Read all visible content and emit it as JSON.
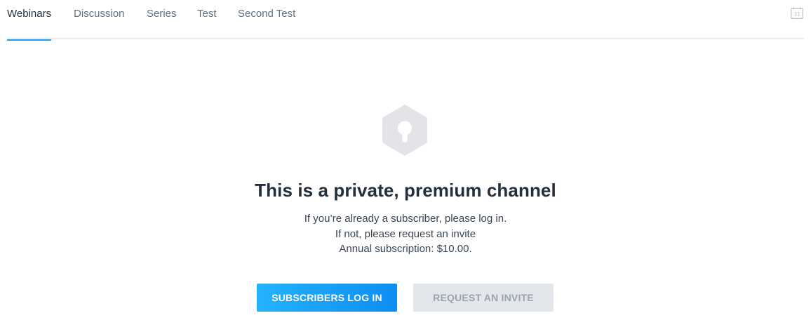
{
  "tabs": [
    {
      "label": "Webinars",
      "active": true
    },
    {
      "label": "Discussion",
      "active": false
    },
    {
      "label": "Series",
      "active": false
    },
    {
      "label": "Test",
      "active": false
    },
    {
      "label": "Second Test",
      "active": false
    }
  ],
  "calendar": {
    "icon": "calendar-icon",
    "day": "31"
  },
  "lock": {
    "icon": "keyhole-lock-icon"
  },
  "message": {
    "title": "This is a private, premium channel",
    "line1": "If you’re already a subscriber, please log in.",
    "line2": "If not, please request an invite",
    "line3": "Annual subscription: $10.00."
  },
  "buttons": {
    "login": "SUBSCRIBERS LOG IN",
    "invite": "REQUEST AN INVITE"
  },
  "colors": {
    "accent": "#1e9bf0",
    "title_text": "#242f3d",
    "disabled_button": "#e3e6ea"
  }
}
